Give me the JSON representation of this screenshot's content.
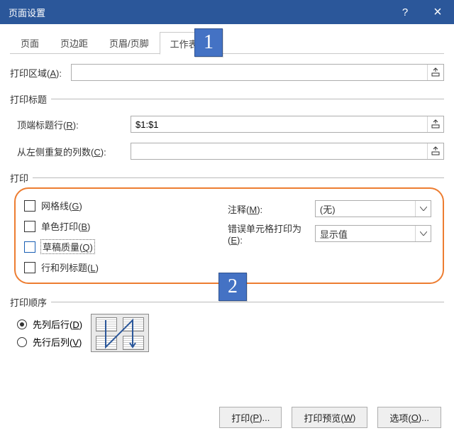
{
  "titlebar": {
    "title": "页面设置",
    "help": "?",
    "close": "×"
  },
  "tabs": {
    "t0": "页面",
    "t1": "页边距",
    "t2": "页眉/页脚",
    "t3": "工作表"
  },
  "callouts": {
    "one": "1",
    "two": "2"
  },
  "area": {
    "label": "打印区域(A):",
    "hotkey": "A",
    "value": ""
  },
  "titles": {
    "legend": "打印标题",
    "topRows_label": "顶端标题行(R):",
    "topRows_hot": "R",
    "topRows_value": "$1:$1",
    "leftCols_label": "从左侧重复的列数(C):",
    "leftCols_hot": "C",
    "leftCols_value": ""
  },
  "print": {
    "legend": "打印",
    "grid": "网格线(G)",
    "grid_hot": "G",
    "bw": "单色打印(B)",
    "bw_hot": "B",
    "draft": "草稿质量(Q)",
    "draft_hot": "Q",
    "rowcol": "行和列标题(L)",
    "rowcol_hot": "L",
    "comments_label": "注释(M):",
    "comments_hot": "M",
    "comments_value": "(无)",
    "errors_label": "错误单元格打印为(E):",
    "errors_hot": "E",
    "errors_value": "显示值"
  },
  "order": {
    "legend": "打印顺序",
    "downOver": "先列后行(D)",
    "downOver_hot": "D",
    "overDown": "先行后列(V)",
    "overDown_hot": "V"
  },
  "footer": {
    "print": "打印(P)...",
    "print_hot": "P",
    "preview": "打印预览(W)",
    "preview_hot": "W",
    "options": "选项(O)...",
    "options_hot": "O"
  }
}
